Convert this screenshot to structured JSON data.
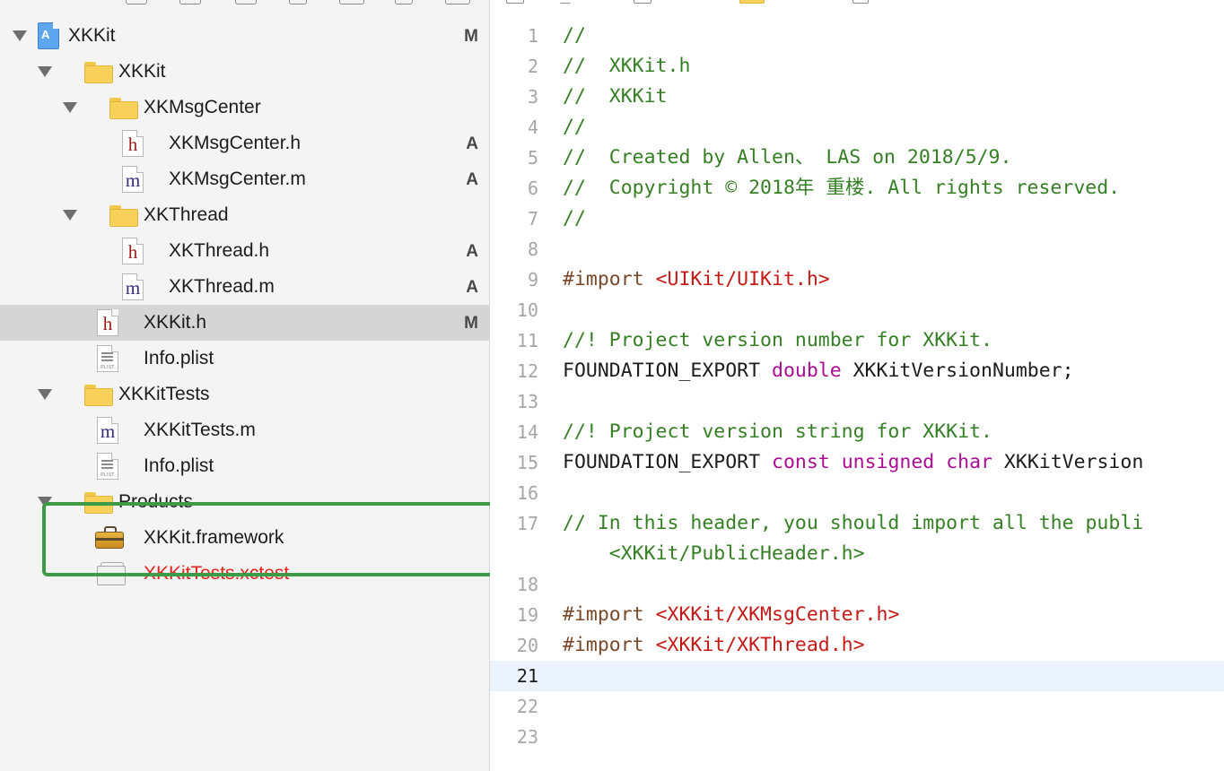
{
  "navigator": {
    "rows": [
      {
        "label": "XKKit",
        "badge": "M",
        "icon": "project-icon",
        "expanded": true
      },
      {
        "label": "XKKit",
        "badge": "",
        "icon": "folder-icon",
        "expanded": true
      },
      {
        "label": "XKMsgCenter",
        "badge": "",
        "icon": "folder-icon",
        "expanded": true
      },
      {
        "label": "XKMsgCenter.h",
        "badge": "A",
        "icon": "header-file-icon"
      },
      {
        "label": "XKMsgCenter.m",
        "badge": "A",
        "icon": "implementation-file-icon"
      },
      {
        "label": "XKThread",
        "badge": "",
        "icon": "folder-icon",
        "expanded": true
      },
      {
        "label": "XKThread.h",
        "badge": "A",
        "icon": "header-file-icon"
      },
      {
        "label": "XKThread.m",
        "badge": "A",
        "icon": "implementation-file-icon"
      },
      {
        "label": "XKKit.h",
        "badge": "M",
        "icon": "header-file-icon",
        "selected": true
      },
      {
        "label": "Info.plist",
        "badge": "",
        "icon": "plist-file-icon"
      },
      {
        "label": "XKKitTests",
        "badge": "",
        "icon": "folder-icon",
        "expanded": true
      },
      {
        "label": "XKKitTests.m",
        "badge": "",
        "icon": "implementation-file-icon"
      },
      {
        "label": "Info.plist",
        "badge": "",
        "icon": "plist-file-icon"
      },
      {
        "label": "Products",
        "badge": "",
        "icon": "folder-icon",
        "expanded": true
      },
      {
        "label": "XKKit.framework",
        "badge": "",
        "icon": "framework-icon"
      },
      {
        "label": "XKKitTests.xctest",
        "badge": "",
        "icon": "xctest-bundle-icon",
        "missing": true
      }
    ],
    "icon_glyphs": {
      "header": "h",
      "implementation": "m",
      "plist": "PLIST"
    }
  },
  "colors": {
    "comment": "#357f24",
    "preprocessor": "#78492a",
    "string": "#c41a16",
    "keyword": "#aa0d91",
    "highlight_box": "#3d9a46",
    "missing_file": "#e0241b"
  },
  "editor": {
    "current_line": 21,
    "lines": [
      {
        "n": "1",
        "tokens": [
          {
            "t": "comment",
            "v": "//"
          }
        ]
      },
      {
        "n": "2",
        "tokens": [
          {
            "t": "comment",
            "v": "//  XKKit.h"
          }
        ]
      },
      {
        "n": "3",
        "tokens": [
          {
            "t": "comment",
            "v": "//  XKKit"
          }
        ]
      },
      {
        "n": "4",
        "tokens": [
          {
            "t": "comment",
            "v": "//"
          }
        ]
      },
      {
        "n": "5",
        "tokens": [
          {
            "t": "comment",
            "v": "//  Created by Allen、 LAS on 2018/5/9."
          }
        ]
      },
      {
        "n": "6",
        "tokens": [
          {
            "t": "comment",
            "v": "//  Copyright © 2018年 重楼. All rights reserved."
          }
        ]
      },
      {
        "n": "7",
        "tokens": [
          {
            "t": "comment",
            "v": "//"
          }
        ]
      },
      {
        "n": "8",
        "tokens": []
      },
      {
        "n": "9",
        "tokens": [
          {
            "t": "preproc",
            "v": "#import "
          },
          {
            "t": "string",
            "v": "<UIKit/UIKit.h>"
          }
        ]
      },
      {
        "n": "10",
        "tokens": []
      },
      {
        "n": "11",
        "tokens": [
          {
            "t": "comment",
            "v": "//! Project version number for XKKit."
          }
        ]
      },
      {
        "n": "12",
        "tokens": [
          {
            "t": "plain",
            "v": "FOUNDATION_EXPORT "
          },
          {
            "t": "keyword",
            "v": "double"
          },
          {
            "t": "plain",
            "v": " XKKitVersionNumber;"
          }
        ]
      },
      {
        "n": "13",
        "tokens": []
      },
      {
        "n": "14",
        "tokens": [
          {
            "t": "comment",
            "v": "//! Project version string for XKKit."
          }
        ]
      },
      {
        "n": "15",
        "tokens": [
          {
            "t": "plain",
            "v": "FOUNDATION_EXPORT "
          },
          {
            "t": "keyword",
            "v": "const"
          },
          {
            "t": "plain",
            "v": " "
          },
          {
            "t": "keyword",
            "v": "unsigned"
          },
          {
            "t": "plain",
            "v": " "
          },
          {
            "t": "keyword",
            "v": "char"
          },
          {
            "t": "plain",
            "v": " XKKitVersion"
          }
        ]
      },
      {
        "n": "16",
        "tokens": []
      },
      {
        "n": "17",
        "tokens": [
          {
            "t": "comment",
            "v": "// In this header, you should import all the publi"
          }
        ]
      },
      {
        "n": "",
        "tokens": [
          {
            "t": "comment",
            "v": "    <XKKit/PublicHeader.h>"
          }
        ]
      },
      {
        "n": "18",
        "tokens": []
      },
      {
        "n": "19",
        "tokens": [
          {
            "t": "preproc",
            "v": "#import "
          },
          {
            "t": "string",
            "v": "<XKKit/XKMsgCenter.h>"
          }
        ]
      },
      {
        "n": "20",
        "tokens": [
          {
            "t": "preproc",
            "v": "#import "
          },
          {
            "t": "string",
            "v": "<XKKit/XKThread.h>"
          }
        ]
      },
      {
        "n": "21",
        "tokens": []
      },
      {
        "n": "22",
        "tokens": []
      },
      {
        "n": "23",
        "tokens": []
      }
    ]
  }
}
